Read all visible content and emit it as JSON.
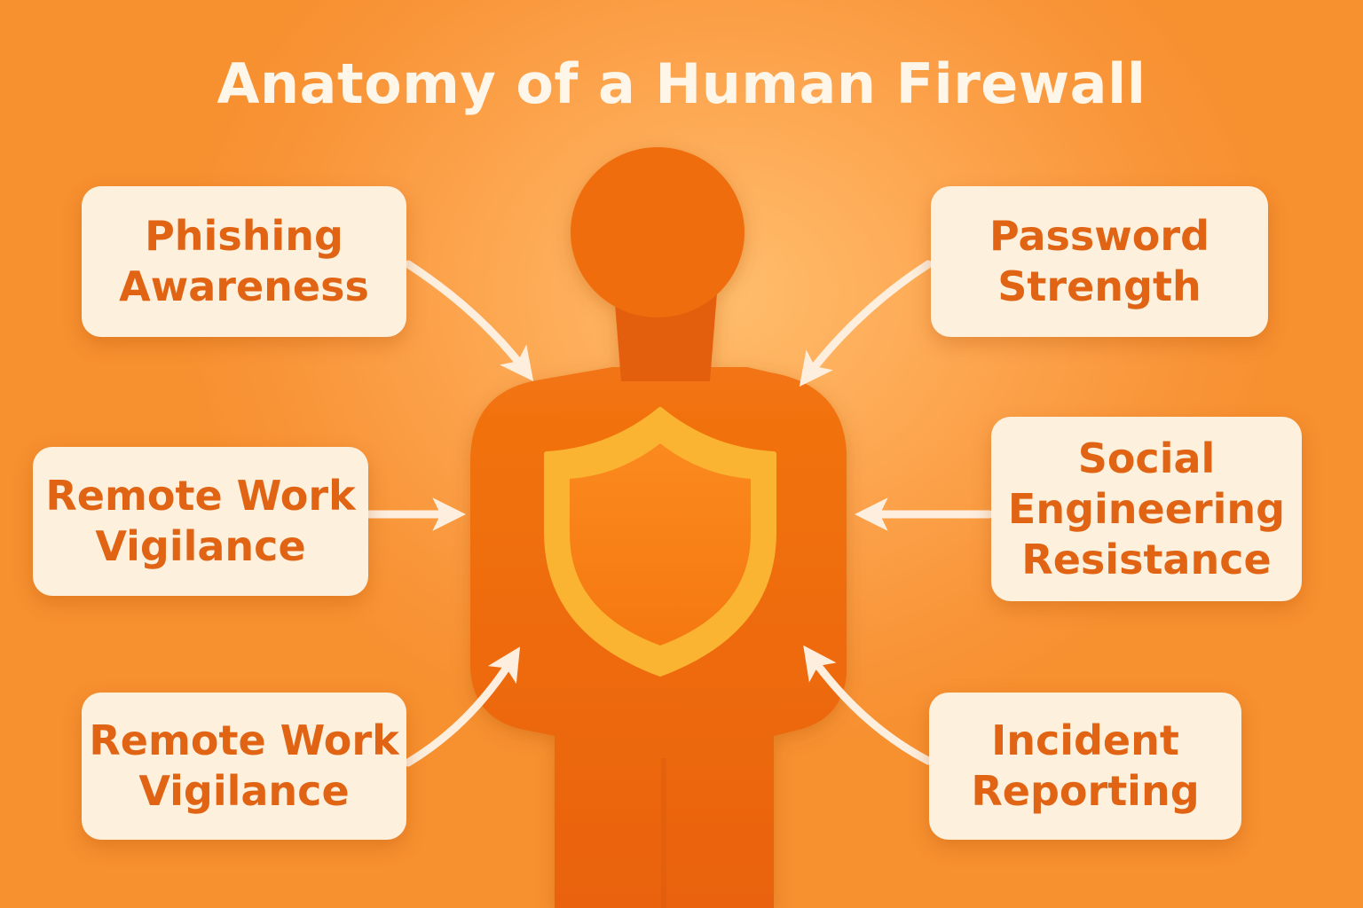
{
  "title": "Anatomy of a Human Firewall",
  "colors": {
    "background": "#fda650",
    "figure": "#f06a0e",
    "shield": "#fbb431",
    "card": "#fdf1dd",
    "card_text": "#e06414",
    "arrow": "#fdeedd",
    "title_text": "#fff6ea"
  },
  "icons": {
    "figure": "person-silhouette-icon",
    "shield": "shield-icon",
    "arrows": "arrow-icon"
  },
  "cards": {
    "phishing": {
      "line1": "Phishing",
      "line2": "Awareness"
    },
    "password": {
      "line1": "Password",
      "line2": "Strength"
    },
    "remote_work_1": {
      "line1": "Remote Work",
      "line2": "Vigilance"
    },
    "social_engineering": {
      "line1": "Social",
      "line2": "Engineering",
      "line3": "Resistance"
    },
    "remote_work_2": {
      "line1": "Remote Work",
      "line2": "Vigilance"
    },
    "incident": {
      "line1": "Incident",
      "line2": "Reporting"
    }
  }
}
